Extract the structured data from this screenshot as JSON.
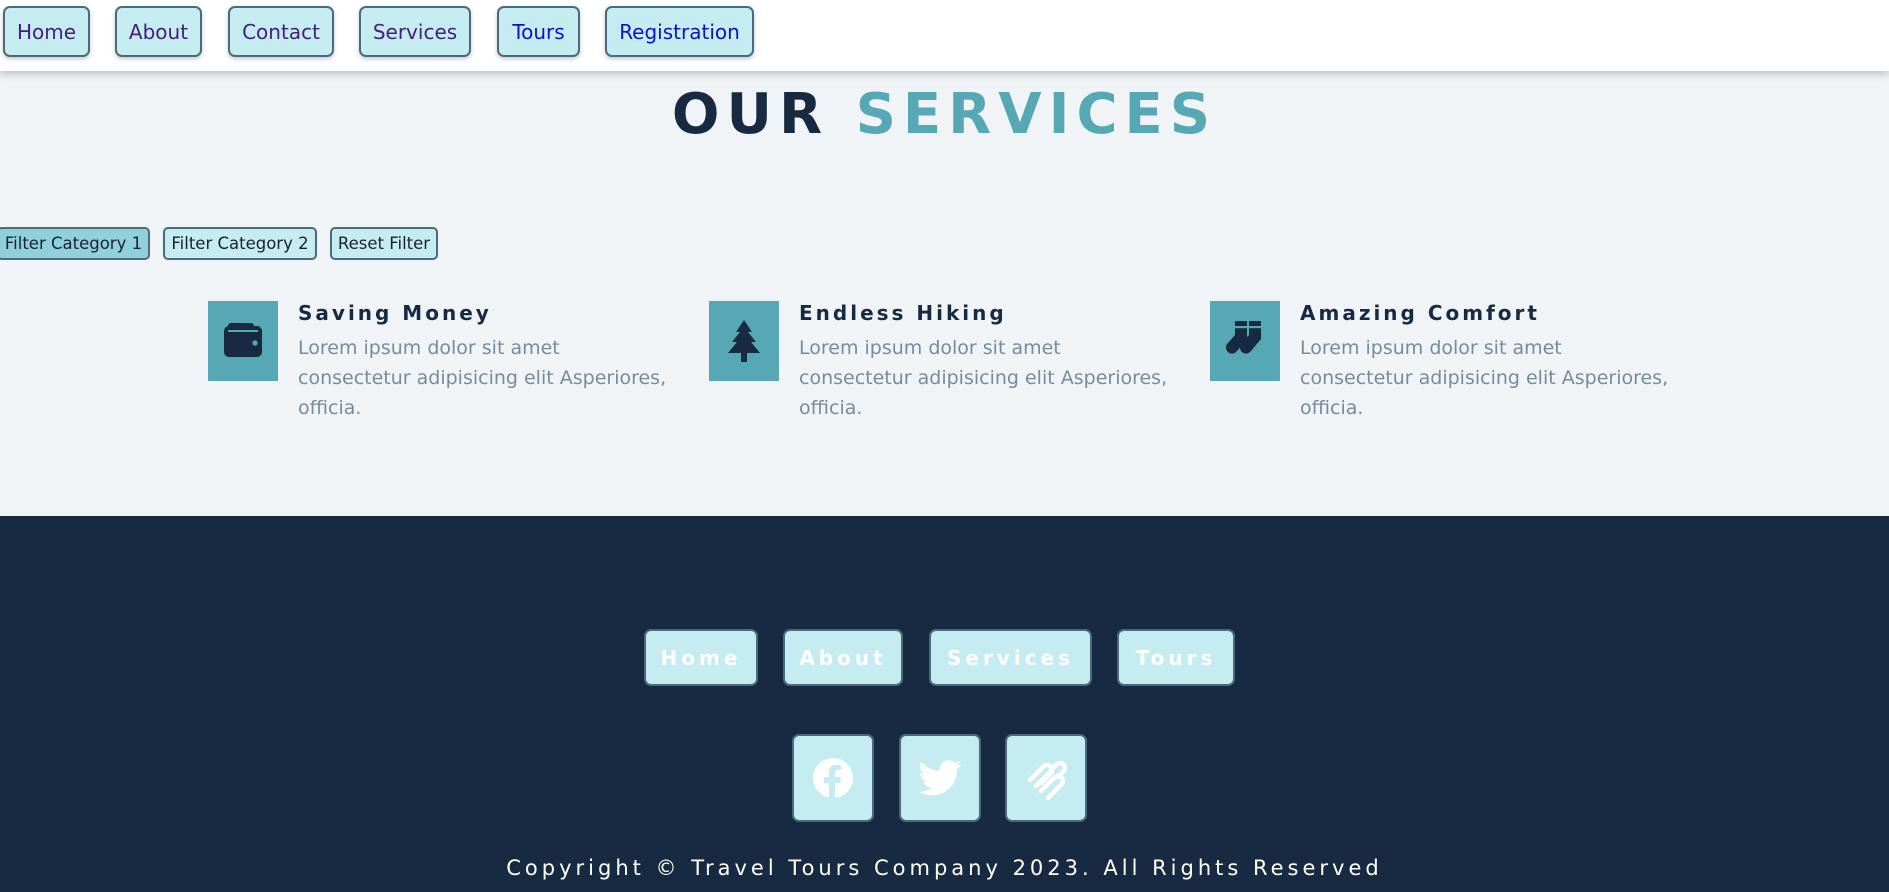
{
  "nav": {
    "items": [
      {
        "label": "Home"
      },
      {
        "label": "About"
      },
      {
        "label": "Contact"
      },
      {
        "label": "Services"
      },
      {
        "label": "Tours"
      },
      {
        "label": "Registration"
      }
    ]
  },
  "heading": {
    "word1": "OUR",
    "word2": "SERVICES"
  },
  "filters": [
    {
      "label": "Filter Category 1"
    },
    {
      "label": "Filter Category 2"
    },
    {
      "label": "Reset Filter"
    }
  ],
  "services": [
    {
      "title": "Saving Money",
      "text": "Lorem ipsum dolor sit amet consectetur adipisicing elit Asperiores, officia.",
      "icon": "wallet-icon"
    },
    {
      "title": "Endless Hiking",
      "text": "Lorem ipsum dolor sit amet consectetur adipisicing elit Asperiores, officia.",
      "icon": "tree-icon"
    },
    {
      "title": "Amazing Comfort",
      "text": "Lorem ipsum dolor sit amet consectetur adipisicing elit Asperiores, officia.",
      "icon": "socks-icon"
    }
  ],
  "footer": {
    "links": [
      {
        "label": "Home"
      },
      {
        "label": "About"
      },
      {
        "label": "Services"
      },
      {
        "label": "Tours"
      }
    ],
    "social": [
      {
        "icon": "facebook-icon"
      },
      {
        "icon": "twitter-icon"
      },
      {
        "icon": "squarespace-icon"
      }
    ],
    "copyright": "Copyright © Travel Tours Company 2023. All Rights Reserved"
  },
  "colors": {
    "accent": "#57a8b5",
    "dark": "#182a42",
    "button_bg": "#c5ecf0",
    "page_bg": "#f0f4f7"
  }
}
